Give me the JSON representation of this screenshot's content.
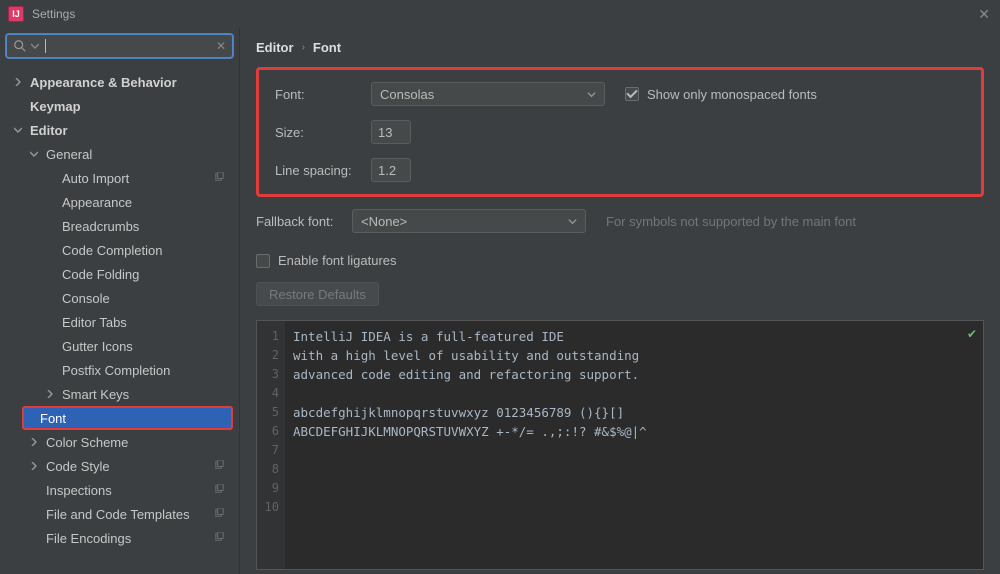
{
  "window": {
    "title": "Settings"
  },
  "search": {
    "value": ""
  },
  "sidebar": {
    "items": [
      {
        "label": "Appearance & Behavior",
        "kind": "group",
        "expanded": false,
        "indent": 0,
        "bold": true
      },
      {
        "label": "Keymap",
        "kind": "item",
        "indent": 0,
        "bold": true
      },
      {
        "label": "Editor",
        "kind": "group",
        "expanded": true,
        "indent": 0,
        "bold": true
      },
      {
        "label": "General",
        "kind": "group",
        "expanded": true,
        "indent": 1
      },
      {
        "label": "Auto Import",
        "kind": "item",
        "indent": 2,
        "copyable": true
      },
      {
        "label": "Appearance",
        "kind": "item",
        "indent": 2
      },
      {
        "label": "Breadcrumbs",
        "kind": "item",
        "indent": 2
      },
      {
        "label": "Code Completion",
        "kind": "item",
        "indent": 2
      },
      {
        "label": "Code Folding",
        "kind": "item",
        "indent": 2
      },
      {
        "label": "Console",
        "kind": "item",
        "indent": 2
      },
      {
        "label": "Editor Tabs",
        "kind": "item",
        "indent": 2
      },
      {
        "label": "Gutter Icons",
        "kind": "item",
        "indent": 2
      },
      {
        "label": "Postfix Completion",
        "kind": "item",
        "indent": 2
      },
      {
        "label": "Smart Keys",
        "kind": "group",
        "expanded": false,
        "indent": 2
      },
      {
        "label": "Font",
        "kind": "item",
        "indent": 1,
        "selected": true
      },
      {
        "label": "Color Scheme",
        "kind": "group",
        "expanded": false,
        "indent": 1
      },
      {
        "label": "Code Style",
        "kind": "group",
        "expanded": false,
        "indent": 1,
        "copyable": true
      },
      {
        "label": "Inspections",
        "kind": "item",
        "indent": 1,
        "copyable": true
      },
      {
        "label": "File and Code Templates",
        "kind": "item",
        "indent": 1,
        "copyable": true
      },
      {
        "label": "File Encodings",
        "kind": "item",
        "indent": 1,
        "copyable": true
      }
    ]
  },
  "breadcrumb": {
    "parent": "Editor",
    "current": "Font"
  },
  "form": {
    "font_label": "Font:",
    "font_value": "Consolas",
    "size_label": "Size:",
    "size_value": "13",
    "line_spacing_label": "Line spacing:",
    "line_spacing_value": "1.2",
    "show_only_mono_label": "Show only monospaced fonts",
    "show_only_mono_checked": true,
    "fallback_label": "Fallback font:",
    "fallback_value": "<None>",
    "fallback_hint": "For symbols not supported by the main font",
    "ligatures_label": "Enable font ligatures",
    "ligatures_checked": false,
    "restore_label": "Restore Defaults"
  },
  "preview": {
    "lines": [
      "IntelliJ IDEA is a full-featured IDE",
      "with a high level of usability and outstanding",
      "advanced code editing and refactoring support.",
      "",
      "abcdefghijklmnopqrstuvwxyz 0123456789 (){}[]",
      "ABCDEFGHIJKLMNOPQRSTUVWXYZ +-*/= .,;:!? #&$%@|^",
      "",
      "",
      "",
      ""
    ]
  }
}
